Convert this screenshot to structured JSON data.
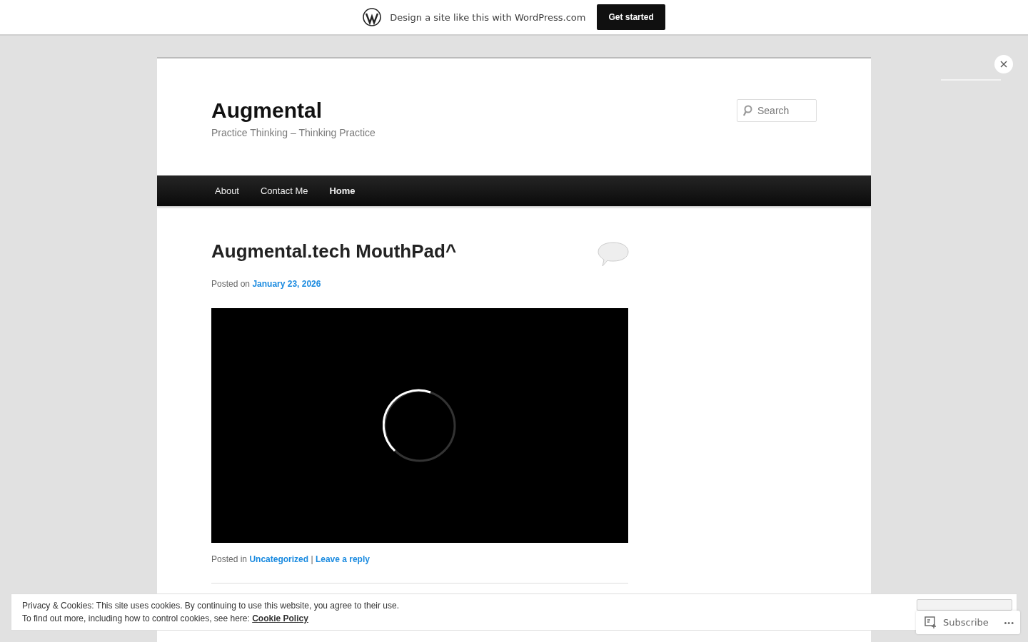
{
  "promo_bar": {
    "text": "Design a site like this with WordPress.com",
    "button": "Get started"
  },
  "site": {
    "title": "Augmental",
    "tagline": "Practice Thinking – Thinking Practice",
    "search": {
      "placeholder": "Search"
    }
  },
  "nav": [
    {
      "label": "About",
      "selected": false
    },
    {
      "label": "Contact Me",
      "selected": false
    },
    {
      "label": "Home",
      "selected": true
    }
  ],
  "post": {
    "title": "Augmental.tech MouthPad^",
    "posted_on": "Posted on",
    "date": "January 23, 2026",
    "posted_in": "Posted in",
    "category": "Uncategorized",
    "separator": "|",
    "reply": "Leave a reply"
  },
  "cookie_notice": {
    "line1": "Privacy & Cookies: This site uses cookies. By continuing to use this website, you agree to their use.",
    "line2": "To find out more, including how to control cookies, see here:",
    "link": "Cookie Policy"
  },
  "subscribe": {
    "label": "Subscribe",
    "more": "•••"
  }
}
